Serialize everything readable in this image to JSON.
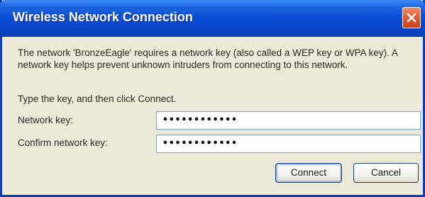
{
  "window": {
    "title": "Wireless Network Connection"
  },
  "message": {
    "line1": "The network 'BronzeEagle' requires a network key (also called a WEP key or WPA key). A",
    "line2": "network key helps prevent unknown intruders from connecting to this network."
  },
  "prompt": "Type the key, and then click Connect.",
  "fields": {
    "network_key": {
      "label": "Network key:",
      "value": "••••••••••••"
    },
    "confirm_key": {
      "label": "Confirm network key:",
      "value": "••••••••••••"
    }
  },
  "buttons": {
    "connect": "Connect",
    "cancel": "Cancel"
  },
  "colors": {
    "titlebar": "#0b4fd6",
    "close": "#e35a2e",
    "dialog_bg": "#ece9d8"
  },
  "icons": {
    "close": "close-icon"
  }
}
